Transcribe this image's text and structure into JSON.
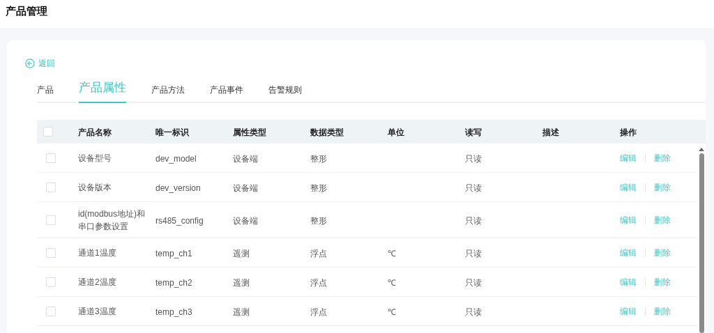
{
  "page_title": "产品管理",
  "back_link": "返回",
  "tabs": [
    {
      "label": "产品",
      "selected": false
    },
    {
      "label": "产品属性",
      "selected": true
    },
    {
      "label": "产品方法",
      "selected": false
    },
    {
      "label": "产品事件",
      "selected": false
    },
    {
      "label": "告警规则",
      "selected": false
    }
  ],
  "table": {
    "select_all": {
      "checked": false
    },
    "columns": [
      "产品名称",
      "唯一标识",
      "属性类型",
      "数据类型",
      "单位",
      "读写",
      "描述",
      "操作"
    ],
    "rows": [
      {
        "checked": false,
        "cells": [
          "设备型号",
          "dev_model",
          "设备端",
          "整形",
          "",
          "只读",
          ""
        ],
        "actions": [
          "编辑",
          "删除"
        ]
      },
      {
        "checked": false,
        "cells": [
          "设备版本",
          "dev_version",
          "设备端",
          "整形",
          "",
          "只读",
          ""
        ],
        "actions": [
          "编辑",
          "删除"
        ]
      },
      {
        "checked": false,
        "cells": [
          "id(modbus地址)和串口参数设置",
          "rs485_config",
          "设备端",
          "整形",
          "",
          "只读",
          ""
        ],
        "actions": [
          "编辑",
          "删除"
        ]
      },
      {
        "checked": false,
        "cells": [
          "通道1温度",
          "temp_ch1",
          "遥测",
          "浮点",
          "℃",
          "只读",
          ""
        ],
        "actions": [
          "编辑",
          "删除"
        ]
      },
      {
        "checked": false,
        "cells": [
          "通道2温度",
          "temp_ch2",
          "遥测",
          "浮点",
          "℃",
          "只读",
          ""
        ],
        "actions": [
          "编辑",
          "删除"
        ]
      },
      {
        "checked": false,
        "cells": [
          "通道3温度",
          "temp_ch3",
          "遥测",
          "浮点",
          "℃",
          "只读",
          ""
        ],
        "actions": [
          "编辑",
          "删除"
        ]
      }
    ]
  }
}
